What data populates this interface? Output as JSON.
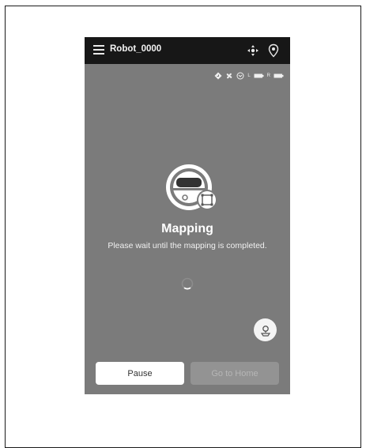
{
  "header": {
    "robot_name": "Robot_0000"
  },
  "status": {
    "battery_left_label": "L",
    "battery_right_label": "R",
    "icons": [
      "navigation-icon",
      "fan-icon",
      "suction-icon",
      "battery-left-icon",
      "battery-right-icon"
    ]
  },
  "main": {
    "title": "Mapping",
    "message": "Please wait until the mapping is completed."
  },
  "buttons": {
    "pause": "Pause",
    "go_home": "Go to Home"
  },
  "colors": {
    "screen_background": "#7b7b7b",
    "top_bar": "#171717",
    "primary_button": "#ffffff",
    "disabled_button": "#939393"
  }
}
